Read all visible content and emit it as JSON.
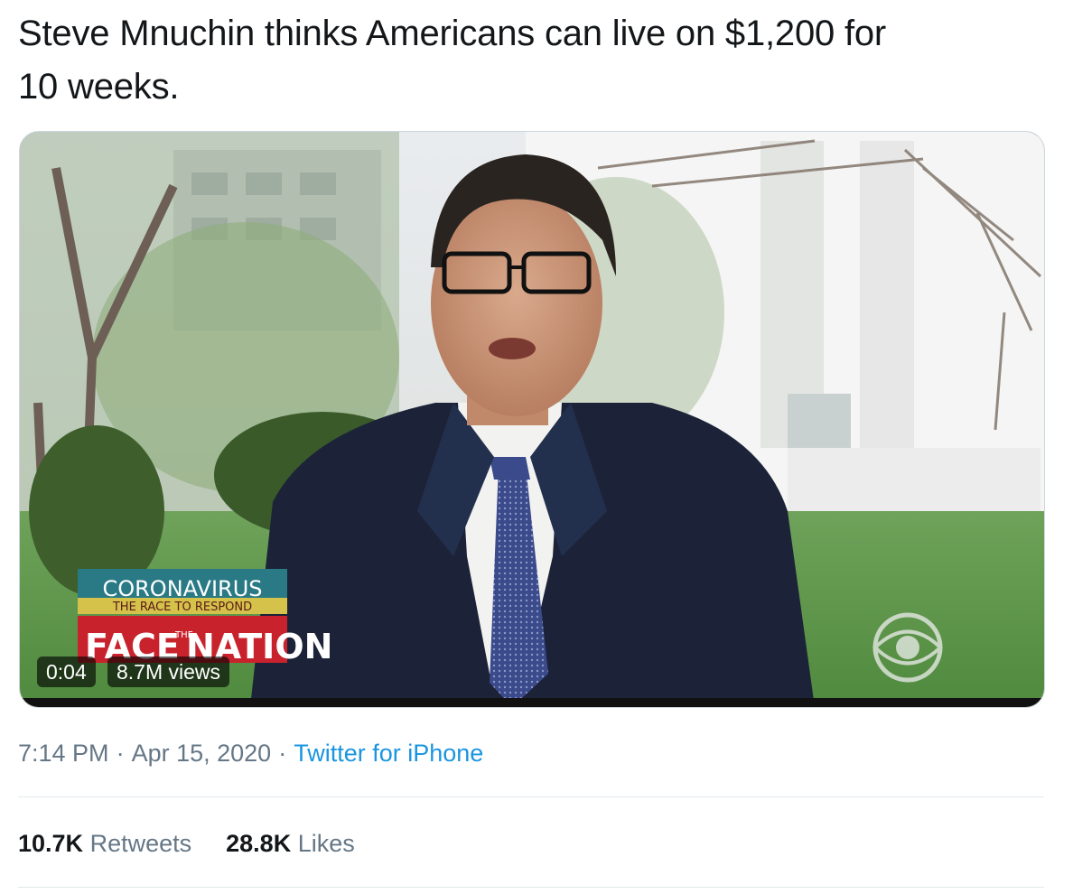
{
  "tweet": {
    "text_line1": "Steve Mnuchin thinks Americans can live on $1,200 for",
    "text_line2": "10 weeks."
  },
  "video": {
    "elapsed": "0:04",
    "views": "8.7M views",
    "progress": 0.0,
    "broadcast_overlay": {
      "line1": "CORONAVIRUS",
      "line2": "THE RACE TO RESPOND",
      "line3_left": "FACE",
      "line3_mid": "THE",
      "line3_right": "NATION"
    },
    "network_logo": "cbs-eye-logo"
  },
  "meta": {
    "time": "7:14 PM",
    "separator": "·",
    "date": "Apr 15, 2020",
    "source": "Twitter for iPhone"
  },
  "stats": {
    "retweets_count": "10.7K",
    "retweets_label": "Retweets",
    "likes_count": "28.8K",
    "likes_label": "Likes"
  },
  "colors": {
    "text": "#14171a",
    "muted": "#657786",
    "link": "#1b95e0",
    "divider": "#e1e8ed",
    "overlay_red": "#c8232c",
    "overlay_teal": "#2a7a86"
  }
}
